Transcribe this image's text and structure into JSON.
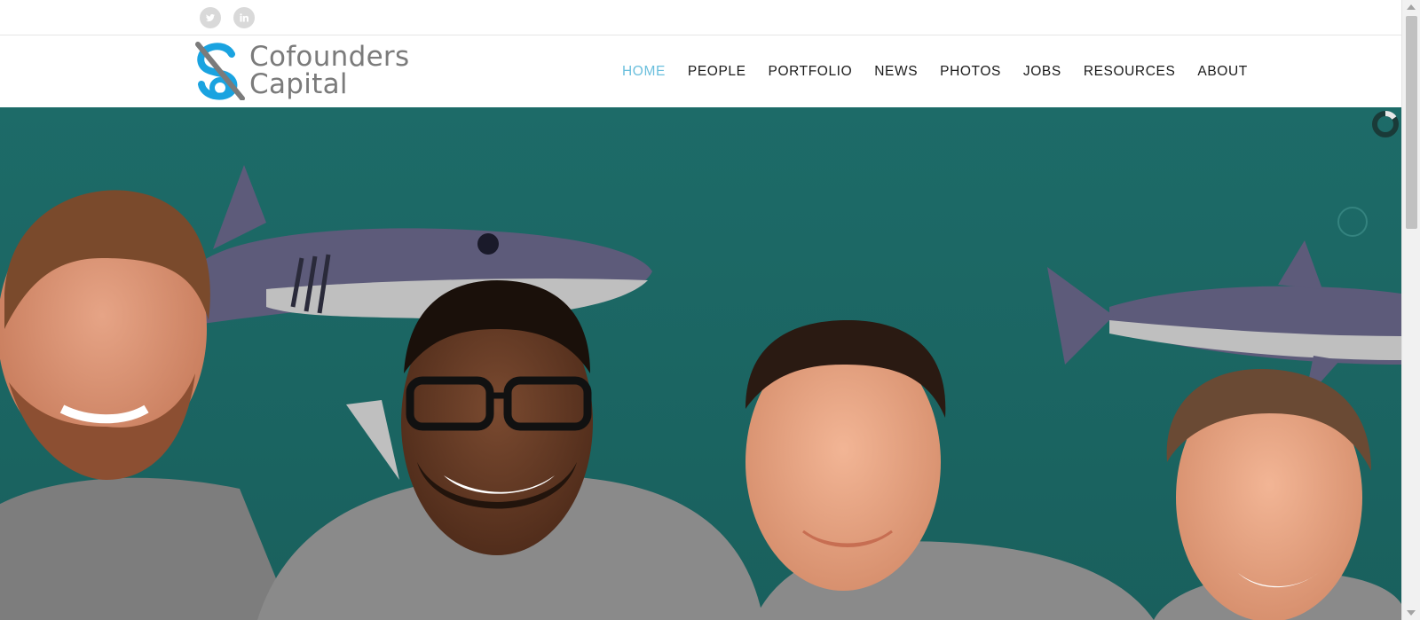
{
  "social": {
    "twitter_icon": "twitter-icon",
    "linkedin_icon": "linkedin-icon"
  },
  "logo": {
    "line1": "Cofounders",
    "line2": "Capital",
    "mark_colors": {
      "blue": "#1aa3e0",
      "gray": "#7b7b7b"
    }
  },
  "nav": {
    "items": [
      {
        "label": "HOME",
        "active": true
      },
      {
        "label": "PEOPLE"
      },
      {
        "label": "PORTFOLIO"
      },
      {
        "label": "NEWS"
      },
      {
        "label": "PHOTOS"
      },
      {
        "label": "JOBS"
      },
      {
        "label": "RESOURCES"
      },
      {
        "label": "ABOUT"
      }
    ],
    "active_color": "#6bbfdd",
    "text_color": "#1a1a1a"
  },
  "hero": {
    "background_color": "#1f6e6a",
    "image": "photo-of-four-smiling-men-in-front-of-shark-mural"
  }
}
